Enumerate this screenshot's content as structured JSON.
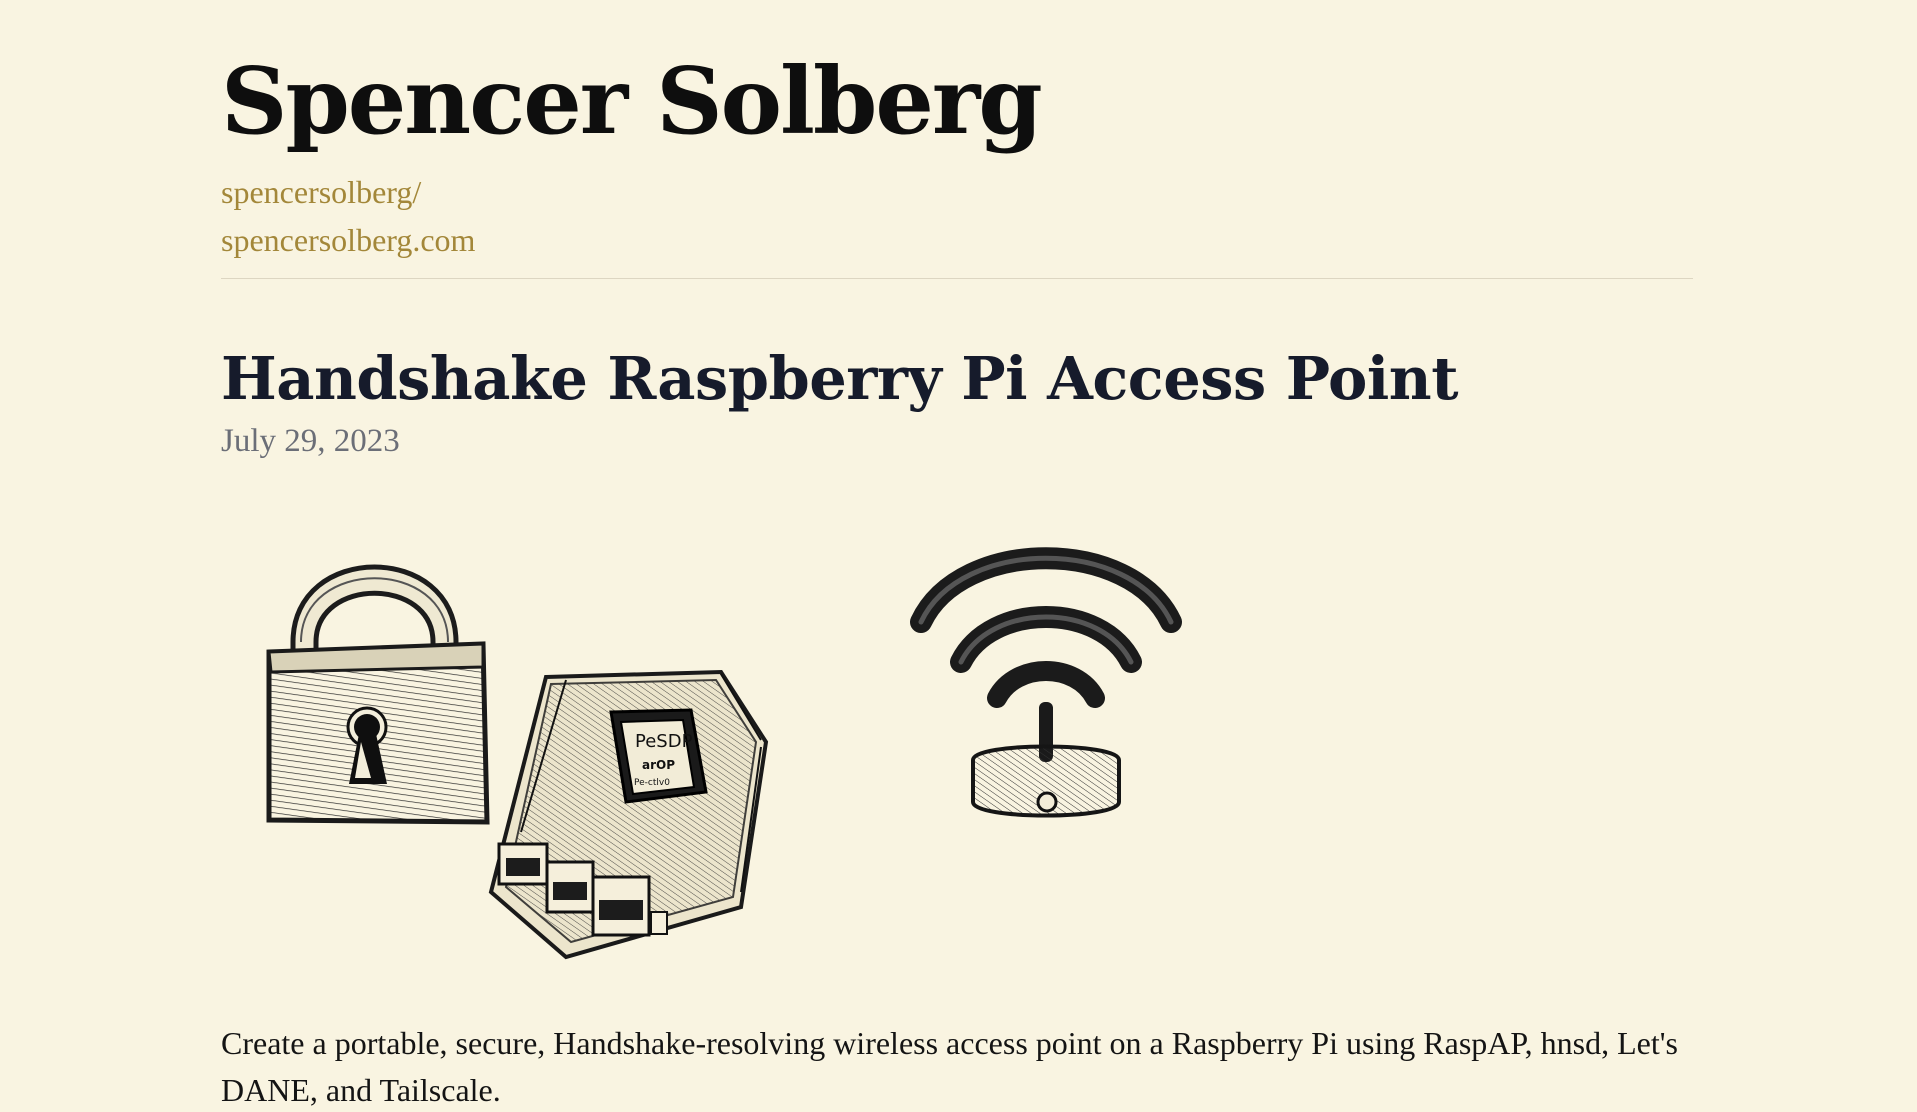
{
  "site": {
    "title": "Spencer Solberg",
    "links": [
      "spencersolberg/",
      "spencersolberg.com"
    ]
  },
  "post": {
    "title": "Handshake Raspberry Pi Access Point",
    "date": "July 29, 2023",
    "excerpt": "Create a portable, secure, Handshake-resolving wireless access point on a Raspberry Pi using RaspAP, hnsd, Let's DANE, and Tailscale.",
    "hero_image": {
      "icons": [
        "padlock-icon",
        "raspberry-pi-board-icon",
        "wifi-router-icon"
      ]
    }
  },
  "colors": {
    "background": "#f9f4e1",
    "link": "#a38739",
    "heading": "#161b2b",
    "date": "#6b6e77",
    "divider": "#ddd6c2"
  }
}
